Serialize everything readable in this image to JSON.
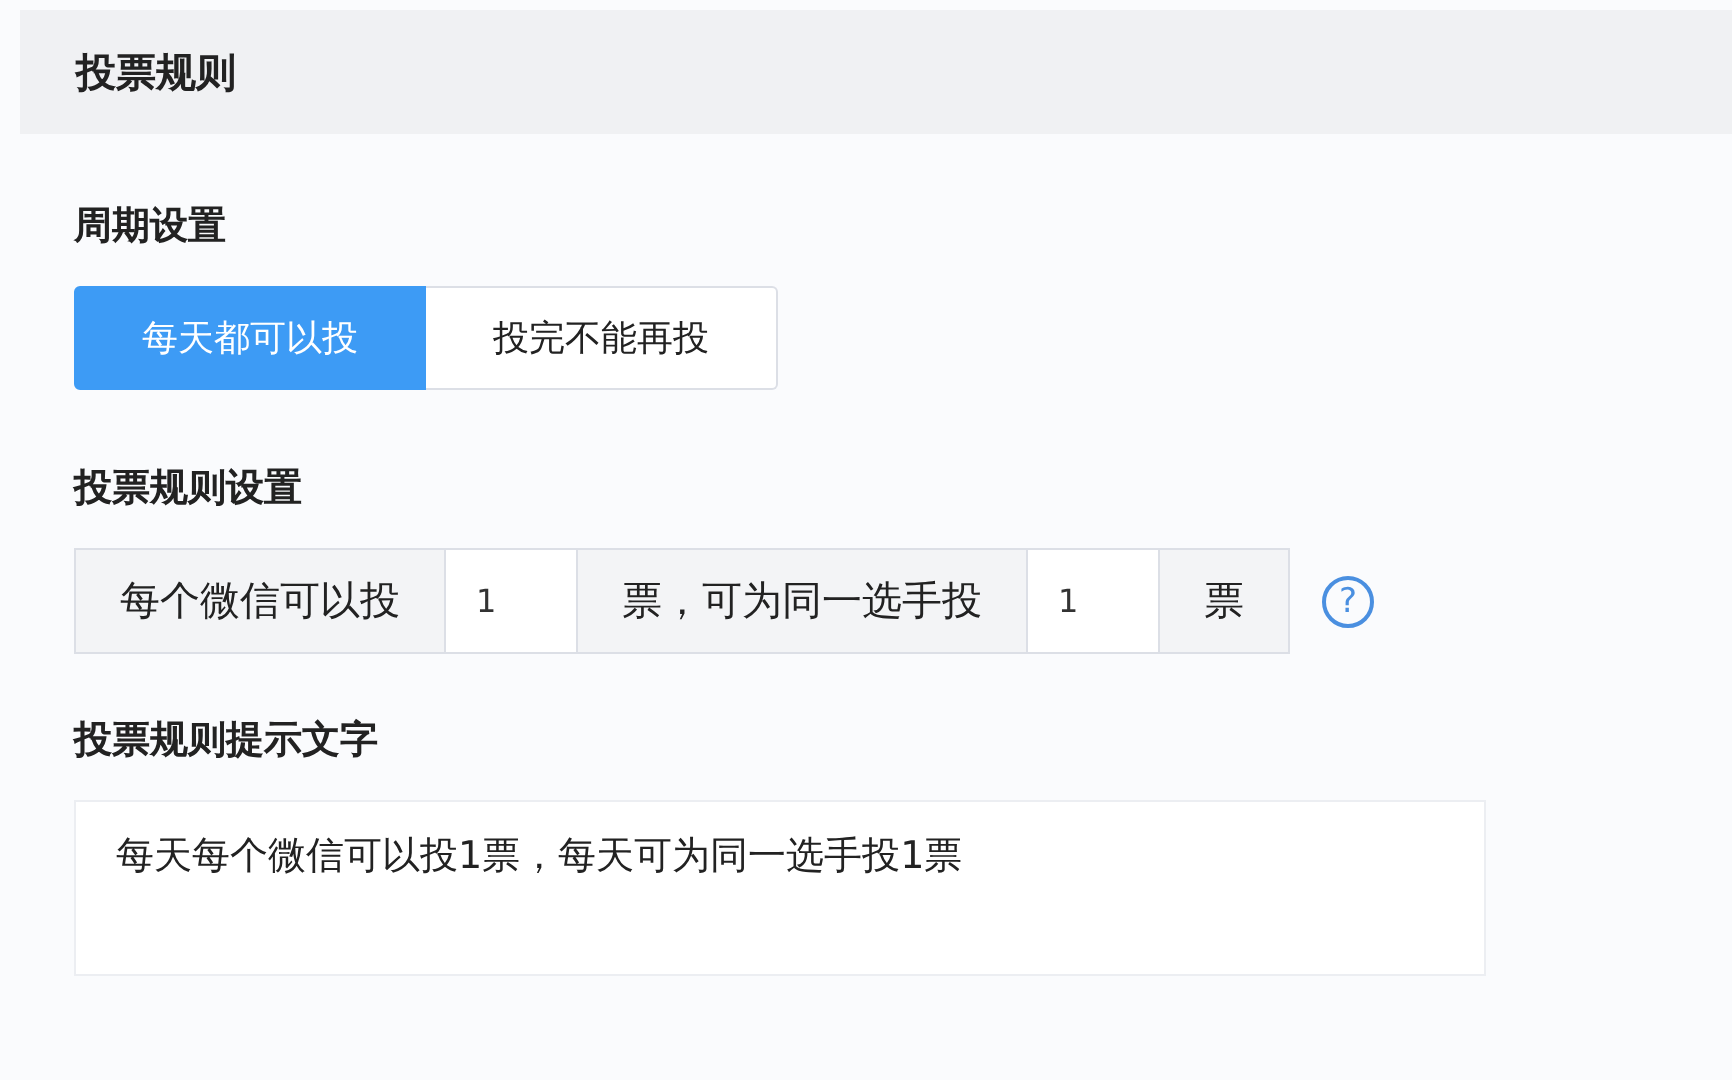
{
  "section": {
    "title": "投票规则"
  },
  "period": {
    "label": "周期设置",
    "options": [
      {
        "label": "每天都可以投",
        "selected": true
      },
      {
        "label": "投完不能再投",
        "selected": false
      }
    ]
  },
  "rule": {
    "label": "投票规则设置",
    "parts": [
      {
        "kind": "addon",
        "text": "每个微信可以投"
      },
      {
        "kind": "input",
        "value": "1"
      },
      {
        "kind": "addon",
        "text": "票，可为同一选手投"
      },
      {
        "kind": "input",
        "value": "1"
      },
      {
        "kind": "addon",
        "text": "票"
      }
    ],
    "help": "?"
  },
  "hint": {
    "label": "投票规则提示文字",
    "value": "每天每个微信可以投1票，每天可为同一选手投1票"
  }
}
